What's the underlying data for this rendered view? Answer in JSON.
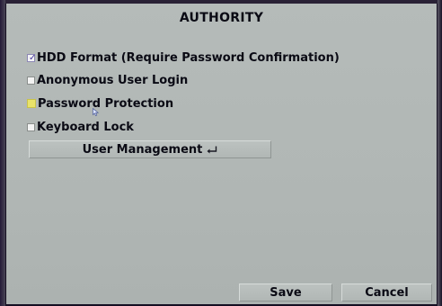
{
  "dialog": {
    "title": "AUTHORITY"
  },
  "options": [
    {
      "label": "HDD Format (Require Password Confirmation)",
      "checked": true,
      "focused": false
    },
    {
      "label": "Anonymous User Login",
      "checked": false,
      "focused": false
    },
    {
      "label": "Password Protection",
      "checked": false,
      "focused": true
    },
    {
      "label": "Keyboard Lock",
      "checked": false,
      "focused": false
    }
  ],
  "buttons": {
    "user_management": "User Management",
    "save": "Save",
    "cancel": "Cancel"
  },
  "icons": {
    "checkmark": "checkmark-icon",
    "enter": "enter-key-icon",
    "cursor": "mouse-cursor-icon"
  },
  "colors": {
    "panel_background": "#b3b9b7",
    "focus_highlight": "#e9e36a",
    "check_color": "#4a3c9c",
    "frame": "#150f22"
  }
}
